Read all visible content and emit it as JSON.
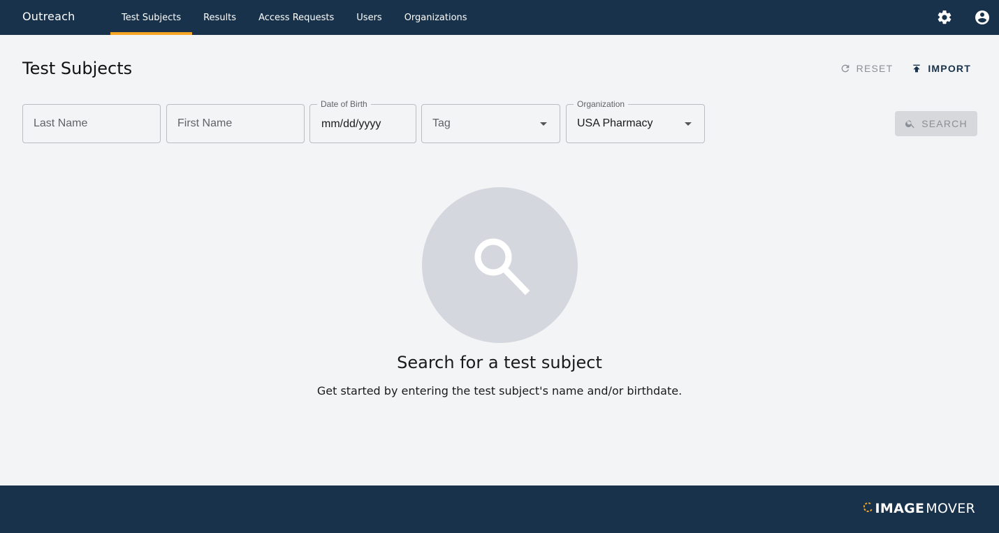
{
  "app": {
    "brand": "Outreach"
  },
  "nav": {
    "tabs": [
      {
        "label": "Test Subjects",
        "active": true
      },
      {
        "label": "Results",
        "active": false
      },
      {
        "label": "Access Requests",
        "active": false
      },
      {
        "label": "Users",
        "active": false
      },
      {
        "label": "Organizations",
        "active": false
      }
    ],
    "icons": [
      "gear-icon",
      "account-circle-icon"
    ],
    "active_color": "#f5a623",
    "bar_color": "#17324a"
  },
  "header": {
    "title": "Test Subjects",
    "reset_label": "RESET",
    "import_label": "IMPORT"
  },
  "filters": {
    "last_name": {
      "placeholder": "Last Name",
      "value": ""
    },
    "first_name": {
      "placeholder": "First Name",
      "value": ""
    },
    "dob": {
      "label": "Date of Birth",
      "value": "mm/dd/yyyy"
    },
    "tag": {
      "placeholder": "Tag",
      "value": ""
    },
    "organization": {
      "label": "Organization",
      "value": "USA Pharmacy"
    },
    "search_label": "SEARCH"
  },
  "empty_state": {
    "icon": "magnifier-icon",
    "title": "Search for a test subject",
    "subtitle": "Get started by entering the test subject's name and/or birthdate."
  },
  "footer": {
    "logo_strong": "IMAGE",
    "logo_light": "MOVER"
  }
}
